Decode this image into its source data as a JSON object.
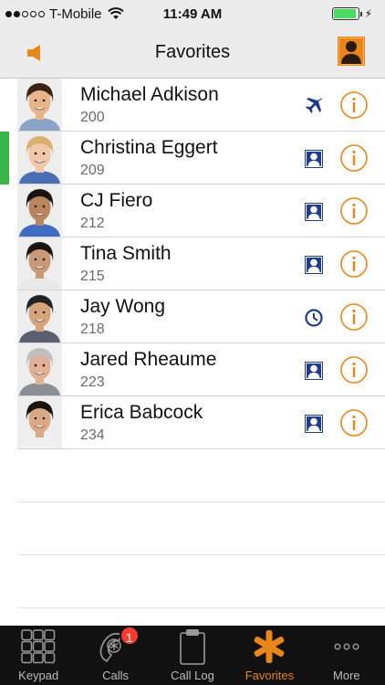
{
  "status_bar": {
    "signal_full": 2,
    "signal_total": 5,
    "carrier": "T-Mobile",
    "time": "11:49 AM",
    "battery_level": 0.95,
    "charging": true
  },
  "nav": {
    "title": "Favorites",
    "left_icon": "speaker-icon",
    "right_icon": "contacts-icon"
  },
  "colors": {
    "accent": "#e8861a",
    "status_blue": "#1f3c8a",
    "active_green": "#3bb54a",
    "badge_red": "#ff3b30"
  },
  "favorites": [
    {
      "name": "Michael Adkison",
      "extension": "200",
      "status": "airplane",
      "active": false,
      "skin": "#e8b48a",
      "hair": "#3a2416",
      "shirt": "#8aa4c8"
    },
    {
      "name": "Christina Eggert",
      "extension": "209",
      "status": "contact",
      "active": true,
      "skin": "#f1c9a8",
      "hair": "#d9b070",
      "shirt": "#4a6fb5"
    },
    {
      "name": "CJ Fiero",
      "extension": "212",
      "status": "contact",
      "active": false,
      "skin": "#b98560",
      "hair": "#1a1410",
      "shirt": "#3f6cc0"
    },
    {
      "name": "Tina Smith",
      "extension": "215",
      "status": "contact",
      "active": false,
      "skin": "#c99a78",
      "hair": "#1d1510",
      "shirt": "#e8e8e8"
    },
    {
      "name": "Jay Wong",
      "extension": "218",
      "status": "clock",
      "active": false,
      "skin": "#d6a47c",
      "hair": "#222222",
      "shirt": "#5a6070"
    },
    {
      "name": "Jared Rheaume",
      "extension": "223",
      "status": "contact",
      "active": false,
      "skin": "#e0b196",
      "hair": "#bfbfbf",
      "shirt": "#8a8f96"
    },
    {
      "name": "Erica Babcock",
      "extension": "234",
      "status": "contact",
      "active": false,
      "skin": "#d9a987",
      "hair": "#1a120c",
      "shirt": "#f0f0f0"
    }
  ],
  "empty_rows": 3,
  "tabs": [
    {
      "label": "Keypad",
      "icon": "keypad-icon",
      "active": false,
      "badge": ""
    },
    {
      "label": "Calls",
      "icon": "calls-icon",
      "active": false,
      "badge": "1"
    },
    {
      "label": "Call Log",
      "icon": "call-log-icon",
      "active": false,
      "badge": ""
    },
    {
      "label": "Favorites",
      "icon": "favorites-asterisk-icon",
      "active": true,
      "badge": ""
    },
    {
      "label": "More",
      "icon": "more-icon",
      "active": false,
      "badge": ""
    }
  ]
}
